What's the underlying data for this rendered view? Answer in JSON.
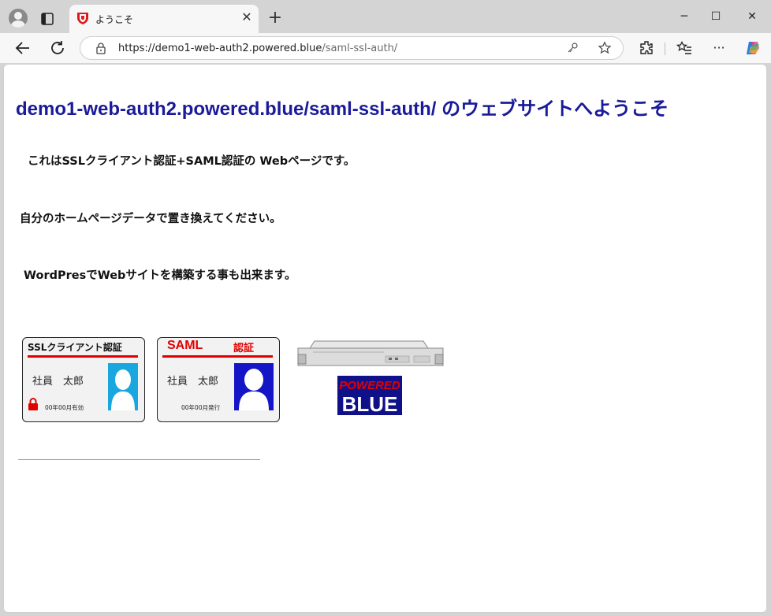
{
  "browser": {
    "tab_title": "ようこそ",
    "url_host": "https://demo1-web-auth2.powered.blue",
    "url_path": "/saml-ssl-auth/"
  },
  "page": {
    "heading": "demo1-web-auth2.powered.blue/saml-ssl-auth/ のウェブサイトへようこそ",
    "paragraph1": "これはSSLクライアント認証+SAML認証の Webページです。",
    "paragraph2": "自分のホームページデータで置き換えてください。",
    "paragraph3": "WordPresでWebサイトを構築する事も出来ます。"
  },
  "cards": {
    "ssl": {
      "title": "SSLクライアント認証",
      "name": "社員　太郎",
      "validity": "00年00月有効"
    },
    "saml": {
      "title_left": "SAML",
      "title_right": "認証",
      "name": "社員　太郎",
      "issued": "00年00月発行"
    }
  },
  "logo": {
    "top": "POWERED",
    "bottom": "BLUE"
  },
  "colors": {
    "heading": "#1a1a9a",
    "ssl_photo": "#1aa7e0",
    "saml_photo": "#1515c8",
    "red_accent": "#e00000",
    "logo_bg": "#101088"
  }
}
